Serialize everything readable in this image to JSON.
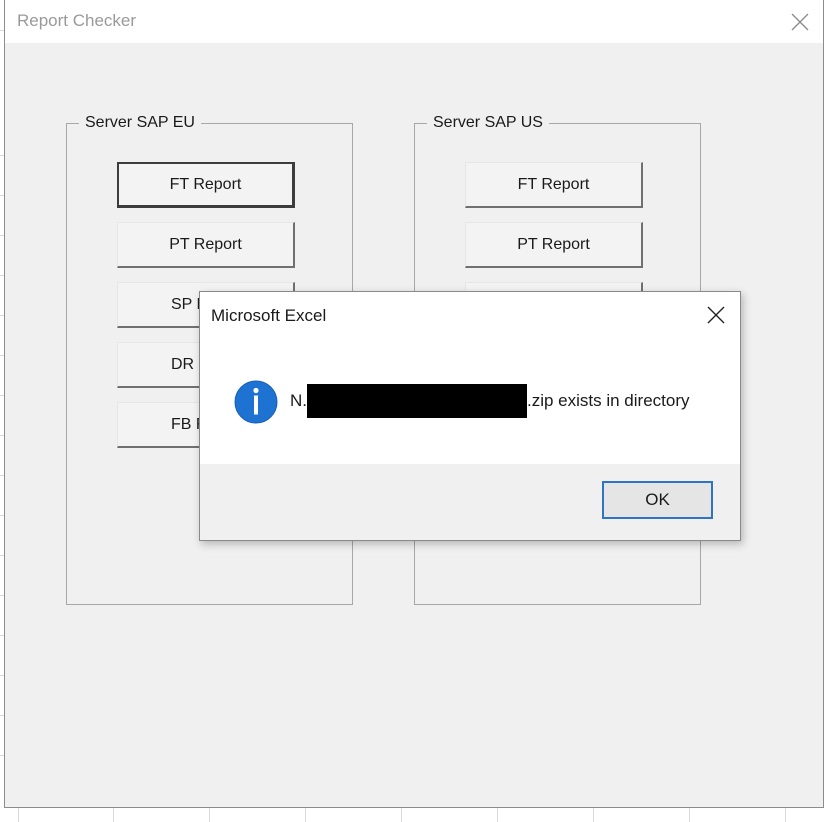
{
  "window": {
    "title": "Report Checker"
  },
  "groups": [
    {
      "legend": "Server SAP EU",
      "buttons": [
        "FT Report",
        "PT Report",
        "SP R",
        "DR R",
        "FB R"
      ]
    },
    {
      "legend": "Server SAP US",
      "buttons": [
        "FT Report",
        "PT Report"
      ]
    }
  ],
  "dialog": {
    "title": "Microsoft Excel",
    "message_prefix": "N.",
    "message_suffix": ".zip exists in directory",
    "ok_label": "OK",
    "icon": "info-icon"
  },
  "colors": {
    "accent": "#2f73c4",
    "info_icon": "#1e73d2"
  }
}
